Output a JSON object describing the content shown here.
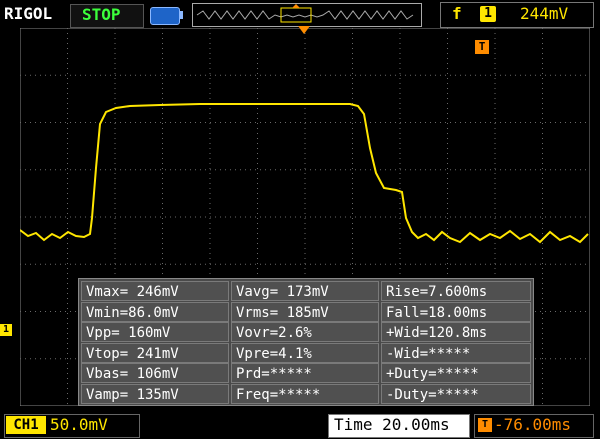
{
  "header": {
    "brand": "RIGOL",
    "run_state": "STOP",
    "trigger_edge_symbol": "f",
    "trigger_source": "1",
    "trigger_level": "244mV"
  },
  "markers": {
    "trigger_flag": "T",
    "channel_marker": "1"
  },
  "measurements": [
    [
      "Vmax= 246mV",
      "Vavg= 173mV",
      "Rise=7.600ms"
    ],
    [
      "Vmin=86.0mV",
      "Vrms= 185mV",
      "Fall=18.00ms"
    ],
    [
      "Vpp= 160mV",
      "Vovr=2.6%",
      "+Wid=120.8ms"
    ],
    [
      "Vtop= 241mV",
      "Vpre=4.1%",
      "-Wid=*****"
    ],
    [
      "Vbas= 106mV",
      "Prd=*****",
      "+Duty=*****"
    ],
    [
      "Vamp= 135mV",
      "Freq=*****",
      "-Duty=*****"
    ]
  ],
  "footer": {
    "channel_label": "CH1",
    "channel_scale": "50.0mV",
    "timebase": "Time 20.00ms",
    "trigger_position": "-76.00ms"
  },
  "colors": {
    "channel1": "#ffe600",
    "trigger": "#ff8c00",
    "run_state": "#3cff3c",
    "grid": "#6a6a6a"
  }
}
